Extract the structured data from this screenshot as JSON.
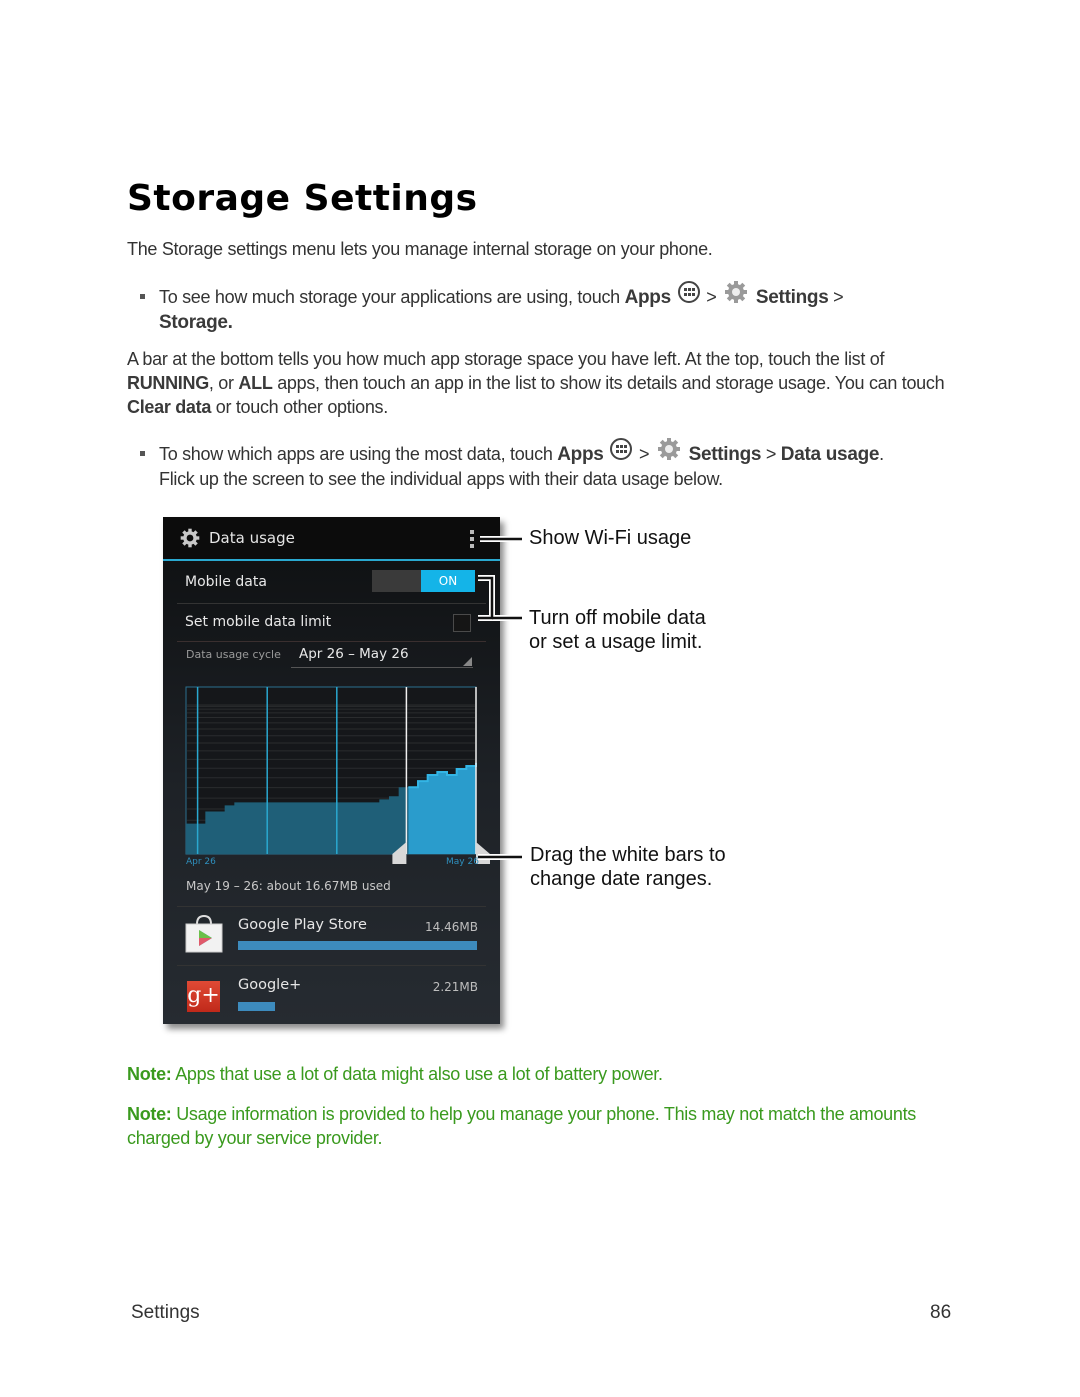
{
  "page": {
    "title": "Storage Settings",
    "intro": "The Storage settings menu lets you manage internal storage on your phone.",
    "bullet1": {
      "pre": "To see how much storage your applications are using, touch ",
      "apps": "Apps",
      "sep1": " > ",
      "settings": "Settings",
      "sep2": " > ",
      "storage": "Storage."
    },
    "para2": {
      "t1": "A bar at the bottom tells you how much app storage space you have left. At the top, touch the list of ",
      "running": "RUNNING",
      "t2": ", or ",
      "all": "ALL",
      "t3": " apps, then touch an app in the list to show its details and storage usage. You can touch ",
      "clear": "Clear data",
      "t4": " or touch other options."
    },
    "bullet2": {
      "pre": "To show which apps are using the most data, touch ",
      "apps": "Apps",
      "sep1": " > ",
      "settings": "Settings",
      "sep2": " > ",
      "data_usage": "Data usage",
      "post": ".",
      "line2": "Flick up the screen to see the individual apps with their data usage below."
    },
    "notes": [
      {
        "label": "Note:",
        "text": " Apps that use a lot of data might also use a lot of battery power."
      },
      {
        "label": "Note:",
        "text": " Usage information is provided to help you manage your phone. This may not match the amounts charged by your service provider."
      }
    ],
    "footer": {
      "section": "Settings",
      "page_number": "86"
    }
  },
  "phone": {
    "header_title": "Data usage",
    "icons": {
      "header": "settings-gear-icon",
      "menu": "overflow-menu-icon",
      "apps": "apps-grid-icon",
      "settings": "settings-gear-icon"
    },
    "mobile_data_label": "Mobile data",
    "mobile_data_toggle": "ON",
    "set_limit_label": "Set mobile data limit",
    "set_limit_checked": false,
    "cycle_label": "Data usage cycle",
    "cycle_value": "Apr 26 – May 26",
    "chart": {
      "start_label": "Apr 26",
      "end_label": "May 26",
      "selected_range": "May 19 – 26",
      "cumulative_profile": [
        0.1,
        0.1,
        0.14,
        0.14,
        0.16,
        0.17,
        0.17,
        0.17,
        0.17,
        0.17,
        0.17,
        0.17,
        0.17,
        0.17,
        0.17,
        0.17,
        0.17,
        0.17,
        0.17,
        0.17,
        0.18,
        0.19,
        0.22,
        0.22,
        0.24,
        0.26,
        0.27,
        0.26,
        0.28,
        0.29,
        0.3
      ],
      "selection_start_fraction": 0.76,
      "selection_end_fraction": 1.0,
      "week_markers": [
        0.04,
        0.28,
        0.52,
        0.76
      ]
    },
    "summary": "May 19 – 26: about 16.67MB used",
    "colors": {
      "accent": "#2aa8d0",
      "toggle_on": "#14b4e8",
      "bar": "#3d8bbd",
      "chart_fill": "#1f5f78",
      "chart_selected": "#2a9ccc"
    },
    "apps": [
      {
        "name": "Google Play Store",
        "size": "14.46MB",
        "usage_fraction": 1.0,
        "icon": "google-play-store-icon"
      },
      {
        "name": "Google+",
        "size": "2.21MB",
        "usage_fraction": 0.153,
        "icon": "google-plus-icon"
      }
    ]
  },
  "callouts": {
    "wifi": "Show Wi-Fi usage",
    "mobile_l1": "Turn off mobile data",
    "mobile_l2": "or set a usage limit.",
    "drag_l1": "Drag the white bars to",
    "drag_l2": "change date ranges."
  }
}
